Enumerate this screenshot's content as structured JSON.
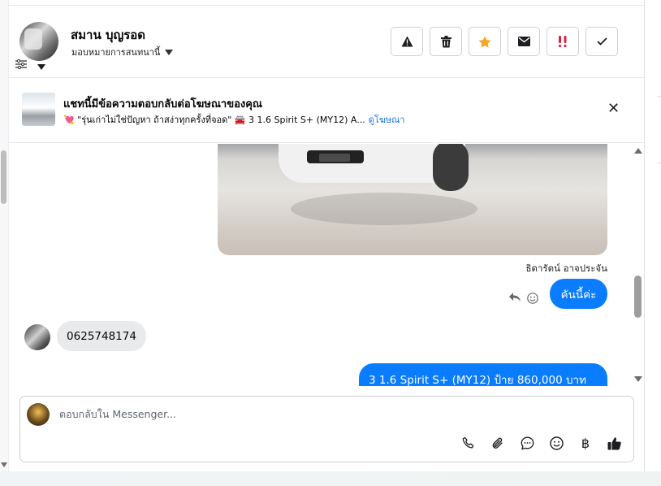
{
  "header": {
    "contact_name": "สมาน บุญรอด",
    "assign_label": "มอบหมายการสนทนานี้",
    "actions": [
      {
        "name": "report-button",
        "icon": "warning-icon"
      },
      {
        "name": "delete-button",
        "icon": "trash-icon"
      },
      {
        "name": "star-button",
        "icon": "star-icon"
      },
      {
        "name": "mark-unread-button",
        "icon": "envelope-icon"
      },
      {
        "name": "follow-up-button",
        "icon": "flag-exclamation-icon"
      },
      {
        "name": "mark-done-button",
        "icon": "check-icon"
      }
    ]
  },
  "ad_banner": {
    "title": "แชทนี้มีข้อความตอบกลับต่อโฆษณาของคุณ",
    "subtitle_prefix": "💘 \"รุ่นเก่าไม่ใช่ปัญหา ถ้าสง่าทุกครั้งที่จอด\" 🚘 3 1.6 Spirit S+ (MY12) A...",
    "link_text": "ดูโฆษณา"
  },
  "thread": {
    "sender_name": "ธิดารัตน์ อาจประจัน",
    "messages": [
      {
        "direction": "out",
        "text": "คันนี้ค่ะ"
      },
      {
        "direction": "in",
        "text": "0625748174"
      },
      {
        "direction": "out",
        "text": "3 1.6 Spirit S+ (MY12) ป้าย 860,000 บาท"
      }
    ]
  },
  "composer": {
    "placeholder": "ตอบกลับใน Messenger...",
    "tools": [
      "phone-icon",
      "paperclip-icon",
      "chat-bubble-icon",
      "emoji-icon",
      "baht-icon",
      "thumbs-up-icon"
    ]
  },
  "colors": {
    "accent": "#0a7cff",
    "star": "#f5a623",
    "follow_up": "#e41e3f",
    "incoming_bubble": "#e9eaec"
  }
}
